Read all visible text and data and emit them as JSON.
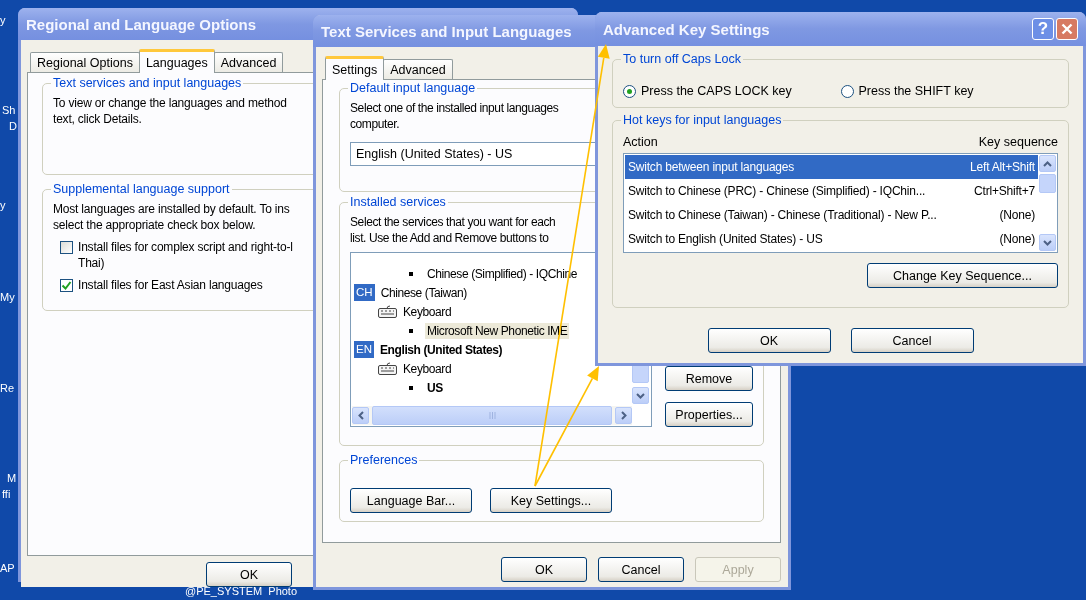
{
  "desktop": {
    "icon_labels": [
      "y",
      "Sh",
      "D",
      "y",
      "My",
      "Re",
      "M",
      "ffi",
      "AP"
    ],
    "bottom_text": "@PE_SYSTEM  Photo"
  },
  "regional_window": {
    "title": "Regional and Language Options",
    "tabs": [
      {
        "label": "Regional Options",
        "selected": false
      },
      {
        "label": "Languages",
        "selected": true
      },
      {
        "label": "Advanced",
        "selected": false
      }
    ],
    "text_services_group": {
      "legend": "Text services and input languages",
      "text": "To view or change the languages and method\ntext, click Details."
    },
    "supplemental_group": {
      "legend": "Supplemental language support",
      "text": "Most languages are installed by default. To ins\nselect the appropriate check box below.",
      "checkboxes": [
        {
          "label": "Install files for complex script and right-to-l\nThai)",
          "checked": false
        },
        {
          "label": "Install files for East Asian languages",
          "checked": true
        }
      ]
    },
    "buttons": [
      {
        "label": "OK"
      }
    ]
  },
  "text_services_window": {
    "title": "Text Services and Input Languages",
    "tabs": [
      {
        "label": "Settings",
        "selected": true
      },
      {
        "label": "Advanced",
        "selected": false
      }
    ],
    "default_language_group": {
      "legend": "Default input language",
      "text": "Select one of the installed input languages\ncomputer.",
      "combo_value": "English (United States) - US"
    },
    "installed_services_group": {
      "legend": "Installed services",
      "text": "Select the services that you want for each\nlist. Use the Add and Remove buttons to",
      "tree": [
        {
          "kind": "service",
          "label": "Chinese (Simplified) - IQChine",
          "selected": false,
          "default": false
        },
        {
          "kind": "language",
          "badge": "CH",
          "label": "Chinese (Taiwan)",
          "selected": false,
          "default": false,
          "children": [
            {
              "kind": "category",
              "label": "Keyboard",
              "selected": false,
              "children": [
                {
                  "kind": "service",
                  "label": "Microsoft New Phonetic IME",
                  "selected": true,
                  "default": false
                }
              ]
            }
          ]
        },
        {
          "kind": "language",
          "badge": "EN",
          "label": "English (United States)",
          "selected": false,
          "default": true,
          "children": [
            {
              "kind": "category",
              "label": "Keyboard",
              "selected": false,
              "children": [
                {
                  "kind": "service",
                  "label": "US",
                  "selected": false,
                  "default": true
                }
              ]
            }
          ]
        }
      ],
      "buttons": [
        {
          "label": "Remove"
        },
        {
          "label": "Properties..."
        }
      ]
    },
    "preferences_group": {
      "legend": "Preferences",
      "buttons": [
        {
          "label": "Language Bar..."
        },
        {
          "label": "Key Settings..."
        }
      ]
    },
    "buttons": [
      {
        "label": "OK",
        "disabled": false
      },
      {
        "label": "Cancel",
        "disabled": false
      },
      {
        "label": "Apply",
        "disabled": true
      }
    ]
  },
  "advanced_key_window": {
    "title": "Advanced Key Settings",
    "help_button": "?",
    "caps_lock_group": {
      "legend": "To turn off Caps Lock",
      "options": [
        {
          "label": "Press the CAPS LOCK key",
          "selected": true
        },
        {
          "label": "Press the SHIFT key",
          "selected": false
        }
      ]
    },
    "hotkeys_group": {
      "legend": "Hot keys for input languages",
      "columns": [
        "Action",
        "Key sequence"
      ],
      "rows": [
        {
          "action": "Switch between input languages",
          "keys": "Left Alt+Shift",
          "selected": true
        },
        {
          "action": "Switch to Chinese (PRC) - Chinese (Simplified) - IQChin...",
          "keys": "Ctrl+Shift+7",
          "selected": false
        },
        {
          "action": "Switch to Chinese (Taiwan) - Chinese (Traditional) - New P...",
          "keys": "(None)",
          "selected": false
        },
        {
          "action": "Switch to English (United States) - US",
          "keys": "(None)",
          "selected": false
        }
      ],
      "button": "Change Key Sequence..."
    },
    "buttons": [
      {
        "label": "OK"
      },
      {
        "label": "Cancel"
      }
    ]
  }
}
